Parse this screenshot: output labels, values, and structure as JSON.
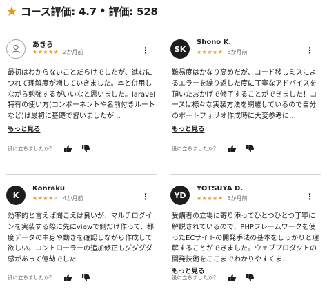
{
  "header": {
    "title": "コース評価: 4.7",
    "ratings": "評価: 528"
  },
  "helpful_prompt": "役に立ちましたか？",
  "read_more": "もっと見る",
  "reviews": [
    {
      "avatar": "",
      "name": "あきら",
      "stars": "★★★★★",
      "stars_off": "",
      "time": "2か月前",
      "text": "最初はわからないことだらけでしたが、進むにつれて理解度が増していきました。本と併用しながら勉強するがいいなと思いました。laravel特有の使い方(コンポーネントや名前付きルートなど)は最初に基礎で習いましたが…"
    },
    {
      "avatar": "SK",
      "name": "Shono K.",
      "stars": "★★★★★",
      "stars_off": "",
      "time": "3か月前",
      "text": "難易度はかなり高めだが、コード移しミスによるエラーを繰り返した度に丁寧なアドバイスを頂いたおかげで修了することができました！コースは様々な実装方法を網羅しているので自分のポートフォリオ作成時に大変参考に…"
    },
    {
      "avatar": "K",
      "name": "Konraku",
      "stars": "★★★★",
      "stars_off": "★",
      "time": "4か月前",
      "text": "効率的と言えば聞こえは良いが、マルチログインを実装する際に先にviewで側だけ作って、都度データの中身や動きを確認しながら作成して欲しい。コントローラーの追加修正もグダグダ感があって億劫でした"
    },
    {
      "avatar": "YD",
      "name": "YOTSUYA D.",
      "stars": "★★★★★",
      "stars_off": "",
      "time": "5か月前",
      "text": "受講者の立場に寄り添ってひとつひとつ丁寧に解説されているので、PHPフレームワークを使ったECサイトの開発手法の基本をしっかりと理解することができました。ウェブプロダクトの開発技術をここまでわかりやすくま…"
    }
  ],
  "colors": {
    "star": "#e59819",
    "text": "#1c1d1f",
    "muted": "#6a6f73",
    "divider": "#d1d7dc"
  }
}
